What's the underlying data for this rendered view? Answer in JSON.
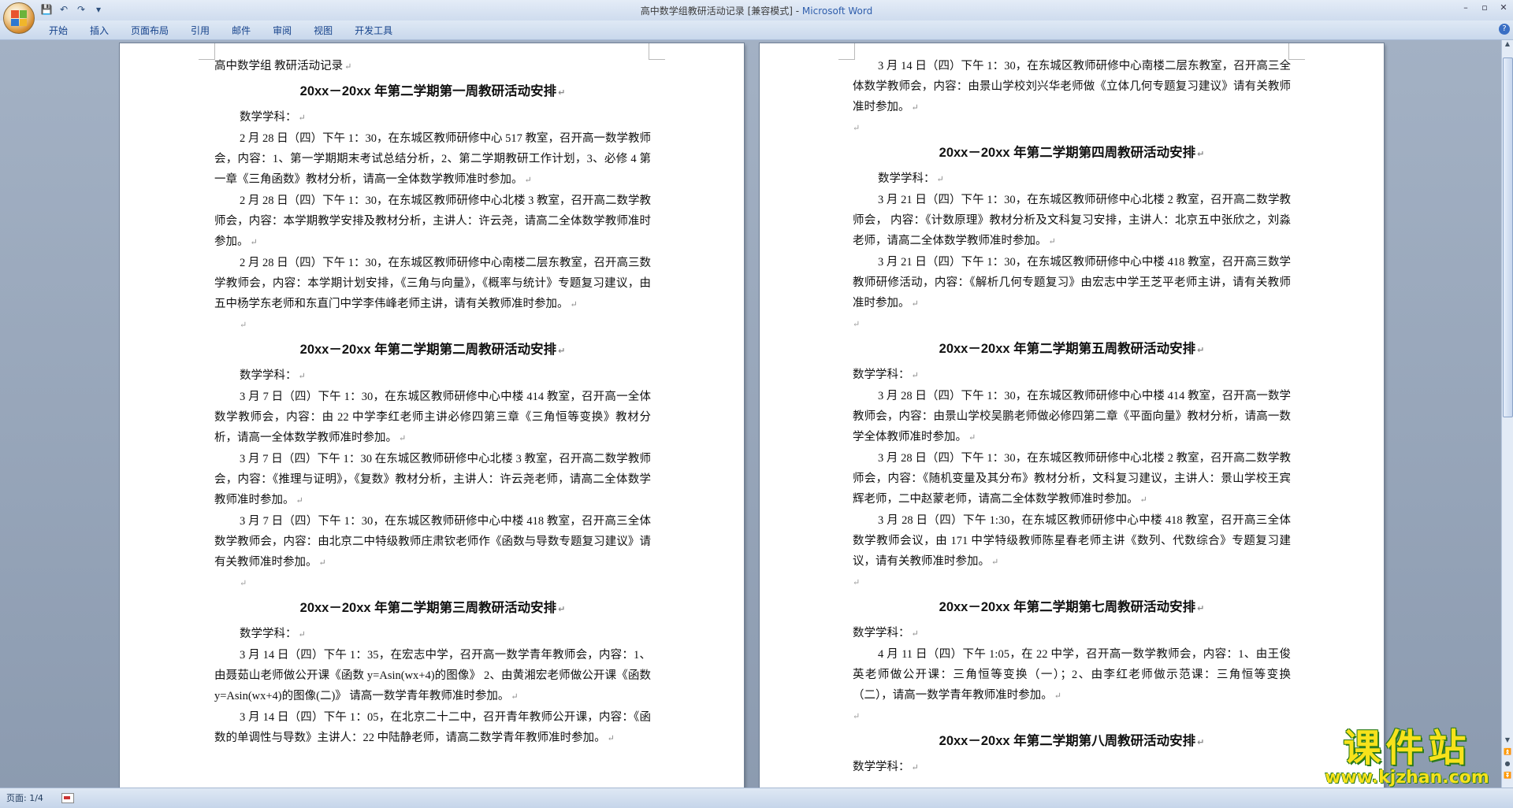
{
  "window": {
    "title_doc": "高中数学组教研活动记录 [兼容模式] - ",
    "title_app": "Microsoft Word",
    "controls": [
      "–",
      "▫",
      "✕"
    ]
  },
  "ribbon": {
    "tabs": [
      "开始",
      "插入",
      "页面布局",
      "引用",
      "邮件",
      "审阅",
      "视图",
      "开发工具"
    ]
  },
  "qat": {
    "save": "💾",
    "undo": "↶",
    "redo": "↷",
    "more": "▾"
  },
  "left_page": {
    "header": "高中数学组 教研活动记录",
    "week1": {
      "heading": "20xx－20xx 年第二学期第一周教研活动安排",
      "subject": "数学学科：",
      "paras": [
        "2 月 28 日（四）下午 1：30，在东城区教师研修中心 517 教室，召开高一数学教师会，内容：1、第一学期期末考试总结分析，2、第二学期教研工作计划，3、必修 4 第一章《三角函数》教材分析，请高一全体数学教师准时参加。",
        "2 月 28 日（四）下午 1：30，在东城区教师研修中心北楼 3 教室，召开高二数学教师会，内容：本学期教学安排及教材分析，主讲人：许云尧，请高二全体数学教师准时参加。",
        "2 月 28 日（四）下午 1：30，在东城区教师研修中心南楼二层东教室，召开高三数学教师会，内容：本学期计划安排，《三角与向量》，《概率与统计》专题复习建议，由五中杨学东老师和东直门中学李伟峰老师主讲，请有关教师准时参加。"
      ]
    },
    "week2": {
      "heading": "20xx－20xx 年第二学期第二周教研活动安排",
      "subject": "数学学科：",
      "paras": [
        "3 月 7 日（四）下午 1：30，在东城区教师研修中心中楼 414 教室，召开高一全体数学教师会，内容：由 22 中学李红老师主讲必修四第三章《三角恒等变换》教材分析，请高一全体数学教师准时参加。",
        "3 月 7 日（四）下午 1：30 在东城区教师研修中心北楼 3 教室，召开高二数学教师会，内容：《推理与证明》，《复数》教材分析，主讲人：许云尧老师，请高二全体数学教师准时参加。",
        "3 月 7 日（四）下午 1：30，在东城区教师研修中心中楼 418 教室，召开高三全体数学教师会，内容：由北京二中特级教师庄肃钦老师作《函数与导数专题复习建议》请有关教师准时参加。"
      ]
    },
    "week3": {
      "heading": "20xx－20xx 年第二学期第三周教研活动安排",
      "subject": "数学学科：",
      "paras": [
        "3 月 14 日（四）下午 1：35，在宏志中学，召开高一数学青年教师会，内容：1、由聂茹山老师做公开课《函数 y=Asin(wx+4)的图像》 2、由黄湘宏老师做公开课《函数 y=Asin(wx+4)的图像(二)》 请高一数学青年教师准时参加。",
        "3 月 14 日（四）下午 1：05，在北京二十二中，召开青年教师公开课，内容：《函数的单调性与导数》主讲人：22 中陆静老师，请高二数学青年教师准时参加。"
      ]
    }
  },
  "right_page": {
    "cont_para": "3 月 14 日（四）下午 1：30，在东城区教师研修中心南楼二层东教室，召开高三全体数学教师会，内容：由景山学校刘兴华老师做《立体几何专题复习建议》请有关教师准时参加。",
    "week4": {
      "heading": "20xx－20xx 年第二学期第四周教研活动安排",
      "subject": "数学学科：",
      "paras": [
        "3 月 21 日（四）下午 1：30，在东城区教师研修中心北楼 2 教室，召开高二数学教师会， 内容：《计数原理》教材分析及文科复习安排，主讲人：北京五中张欣之，刘淼老师，请高二全体数学教师准时参加。",
        "3 月 21 日（四）下午 1：30，在东城区教师研修中心中楼 418 教室，召开高三数学教师研修活动，内容：《解析几何专题复习》由宏志中学王芝平老师主讲，请有关教师准时参加。"
      ]
    },
    "week5": {
      "heading": "20xx－20xx 年第二学期第五周教研活动安排",
      "subject": "数学学科：",
      "paras": [
        "3 月 28 日（四）下午 1：30，在东城区教师研修中心中楼 414 教室，召开高一数学教师会，内容：由景山学校吴鹏老师做必修四第二章《平面向量》教材分析，请高一数学全体教师准时参加。",
        "3 月 28 日（四）下午 1：30，在东城区教师研修中心北楼 2 教室，召开高二数学教师会，内容：《随机变量及其分布》教材分析，文科复习建议，主讲人：景山学校王宾辉老师，二中赵蒙老师，请高二全体数学教师准时参加。",
        "3 月 28 日（四）下午 1:30，在东城区教师研修中心中楼 418 教室，召开高三全体数学教师会议，由 171 中学特级教师陈星春老师主讲《数列、代数综合》专题复习建议，请有关教师准时参加。"
      ]
    },
    "week7": {
      "heading": "20xx－20xx 年第二学期第七周教研活动安排",
      "subject": "数学学科：",
      "paras": [
        "4 月 11 日（四）下午 1:05，在 22 中学，召开高一数学教师会，内容：1、由王俊英老师做公开课：三角恒等变换（一）；2、由李红老师做示范课：三角恒等变换（二），请高一数学青年教师准时参加。"
      ]
    },
    "week8": {
      "heading": "20xx－20xx 年第二学期第八周教研活动安排",
      "subject": "数学学科："
    }
  },
  "status": {
    "page": "页面: 1/4"
  },
  "watermark": {
    "big": "课件站",
    "small": "www.kjzhan.com"
  },
  "marks": {
    "para": "↵"
  }
}
